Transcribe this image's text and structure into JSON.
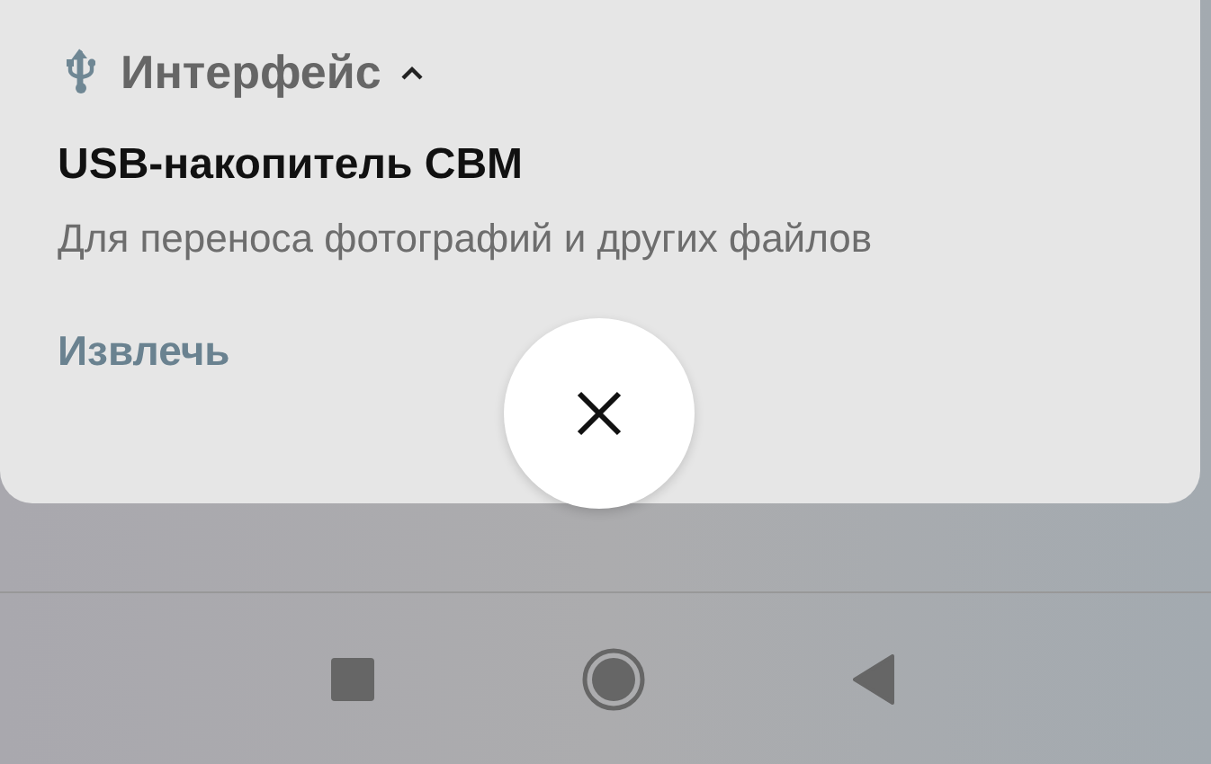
{
  "notification": {
    "app_name": "Интерфейс",
    "expanded": true,
    "title": "USB-накопитель CBM",
    "text": "Для переноса фотографий и других файлов",
    "actions": [
      "Извлечь"
    ]
  }
}
